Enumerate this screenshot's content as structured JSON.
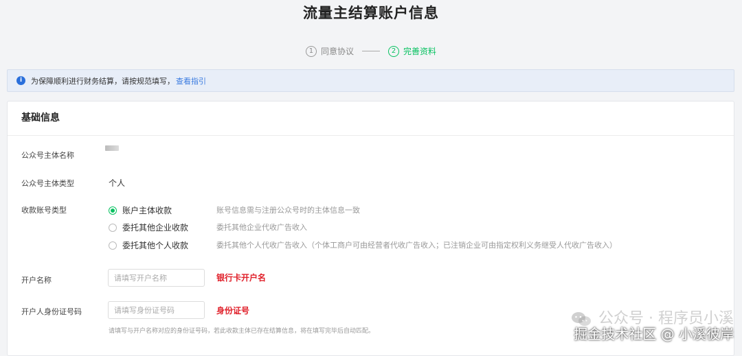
{
  "page": {
    "title": "流量主结算账户信息"
  },
  "steps": [
    {
      "index": "1",
      "label": "同意协议",
      "active": false
    },
    {
      "index": "2",
      "label": "完善资料",
      "active": true
    }
  ],
  "notice": {
    "text": "为保障顺利进行财务结算，请按规范填写，",
    "link": "查看指引"
  },
  "card": {
    "title": "基础信息",
    "entity_name_label": "公众号主体名称",
    "entity_type_label": "公众号主体类型",
    "entity_type_value": "个人",
    "account_type_label": "收款账号类型",
    "account_options": [
      {
        "label": "账户主体收款",
        "desc": "账号信息需与注册公众号时的主体信息一致",
        "checked": true
      },
      {
        "label": "委托其他企业收款",
        "desc": "委托其他企业代收广告收入",
        "checked": false
      },
      {
        "label": "委托其他个人收款",
        "desc": "委托其他个人代收广告收入（个体工商户可由经营者代收广告收入；已注销企业可由指定权利义务继受人代收广告收入）",
        "checked": false
      }
    ],
    "account_name_label": "开户名称",
    "account_name_placeholder": "请填写开户名称",
    "account_name_annotation": "银行卡开户名",
    "id_label": "开户人身份证号码",
    "id_placeholder": "请填写身份证号码",
    "id_annotation": "身份证号",
    "id_hint": "请填写与开户名称对应的身份证号码，若此收款主体已存在结算信息，将在填写完毕后自动匹配。"
  },
  "watermark": {
    "line1": "公众号 · 程序员小溪",
    "line2": "掘金技术社区 @ 小溪彼岸"
  },
  "colors": {
    "accent": "#07c160",
    "link": "#3a7be0",
    "annotation": "#e0202a"
  }
}
